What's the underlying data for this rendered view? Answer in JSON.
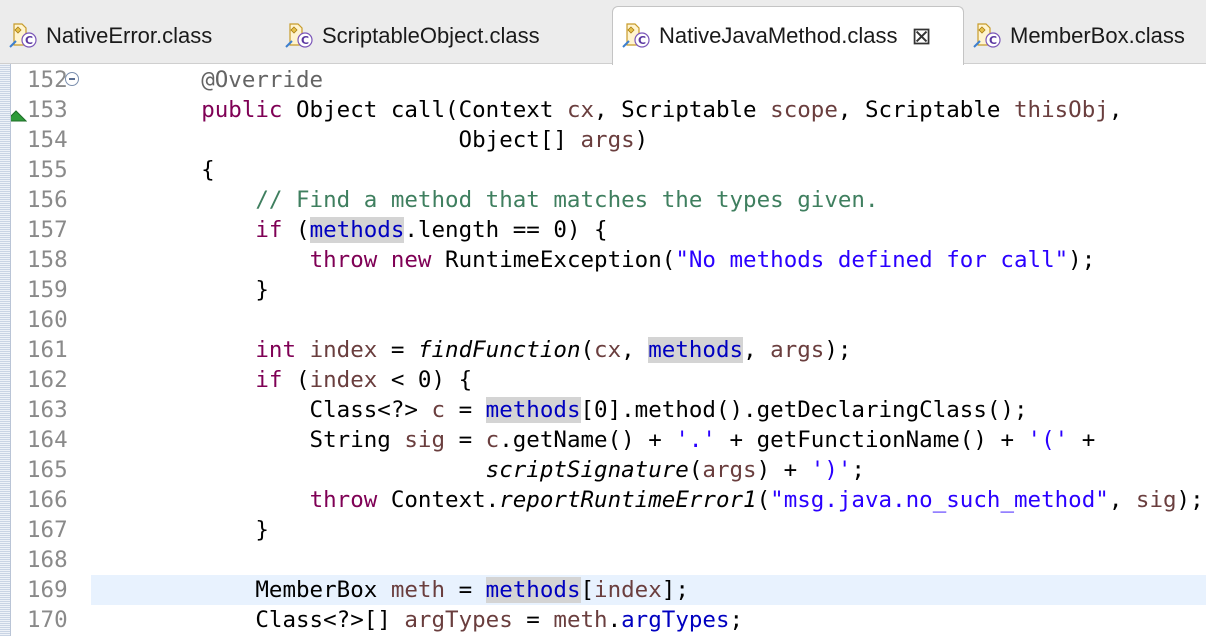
{
  "tabs": [
    {
      "label": "NativeError.class",
      "active": false,
      "icon": "class-file-icon"
    },
    {
      "label": "ScriptableObject.class",
      "active": false,
      "icon": "class-file-icon"
    },
    {
      "label": "NativeJavaMethod.class",
      "active": true,
      "icon": "class-file-icon",
      "close": "⊠"
    },
    {
      "label": "MemberBox.class",
      "active": false,
      "icon": "class-file-icon"
    }
  ],
  "colors": {
    "keyword": "#7f0055",
    "field": "#0000c0",
    "string": "#2a00ff",
    "comment": "#3f7f5f",
    "local_variable": "#6a3e3e",
    "annotation": "#646464",
    "current_line": "#e8f2fe",
    "occurrence_highlight": "#d4d4d4"
  },
  "editor": {
    "current_line": 169,
    "lines": [
      {
        "n": "152",
        "fold": "collapse",
        "tokens": [
          [
            "    ",
            ""
          ],
          [
            "@Override",
            "ann"
          ]
        ]
      },
      {
        "n": "153",
        "marker": "override-marker",
        "tokens": [
          [
            "    ",
            ""
          ],
          [
            "public",
            "kw"
          ],
          [
            " Object call(Context ",
            ""
          ],
          [
            "cx",
            "var"
          ],
          [
            ", Scriptable ",
            ""
          ],
          [
            "scope",
            "var"
          ],
          [
            ", Scriptable ",
            ""
          ],
          [
            "thisObj",
            "var"
          ],
          [
            ",",
            ""
          ]
        ]
      },
      {
        "n": "154",
        "tokens": [
          [
            "                       Object[] ",
            ""
          ],
          [
            "args",
            "var"
          ],
          [
            ")",
            ""
          ]
        ]
      },
      {
        "n": "155",
        "tokens": [
          [
            "    {",
            ""
          ]
        ]
      },
      {
        "n": "156",
        "tokens": [
          [
            "        ",
            ""
          ],
          [
            "// Find a method that matches the types given.",
            "cmt"
          ]
        ]
      },
      {
        "n": "157",
        "tokens": [
          [
            "        ",
            ""
          ],
          [
            "if",
            "kw"
          ],
          [
            " (",
            ""
          ],
          [
            "methods",
            "fld hl"
          ],
          [
            ".length == 0) {",
            ""
          ]
        ]
      },
      {
        "n": "158",
        "tokens": [
          [
            "            ",
            ""
          ],
          [
            "throw",
            "kw"
          ],
          [
            " ",
            ""
          ],
          [
            "new",
            "kw"
          ],
          [
            " RuntimeException(",
            ""
          ],
          [
            "\"No methods defined for call\"",
            "str"
          ],
          [
            ");",
            ""
          ]
        ]
      },
      {
        "n": "159",
        "tokens": [
          [
            "        }",
            ""
          ]
        ]
      },
      {
        "n": "160",
        "tokens": []
      },
      {
        "n": "161",
        "tokens": [
          [
            "        ",
            ""
          ],
          [
            "int",
            "kw"
          ],
          [
            " ",
            ""
          ],
          [
            "index",
            "var"
          ],
          [
            " = ",
            ""
          ],
          [
            "findFunction",
            "ital"
          ],
          [
            "(",
            ""
          ],
          [
            "cx",
            "var"
          ],
          [
            ", ",
            ""
          ],
          [
            "methods",
            "fld hl"
          ],
          [
            ", ",
            ""
          ],
          [
            "args",
            "var"
          ],
          [
            ");",
            ""
          ]
        ]
      },
      {
        "n": "162",
        "tokens": [
          [
            "        ",
            ""
          ],
          [
            "if",
            "kw"
          ],
          [
            " (",
            ""
          ],
          [
            "index",
            "var"
          ],
          [
            " < 0) {",
            ""
          ]
        ]
      },
      {
        "n": "163",
        "tokens": [
          [
            "            Class<?> ",
            ""
          ],
          [
            "c",
            "var"
          ],
          [
            " = ",
            ""
          ],
          [
            "methods",
            "fld hl"
          ],
          [
            "[0].method().getDeclaringClass();",
            ""
          ]
        ]
      },
      {
        "n": "164",
        "tokens": [
          [
            "            String ",
            ""
          ],
          [
            "sig",
            "var"
          ],
          [
            " = ",
            ""
          ],
          [
            "c",
            "var"
          ],
          [
            ".getName() + ",
            ""
          ],
          [
            "'.'",
            "str"
          ],
          [
            " + getFunctionName() + ",
            ""
          ],
          [
            "'('",
            "str"
          ],
          [
            " +",
            ""
          ]
        ]
      },
      {
        "n": "165",
        "tokens": [
          [
            "                         ",
            ""
          ],
          [
            "scriptSignature",
            "ital"
          ],
          [
            "(",
            ""
          ],
          [
            "args",
            "var"
          ],
          [
            ") + ",
            ""
          ],
          [
            "')'",
            "str"
          ],
          [
            ";",
            ""
          ]
        ]
      },
      {
        "n": "166",
        "tokens": [
          [
            "            ",
            ""
          ],
          [
            "throw",
            "kw"
          ],
          [
            " Context.",
            ""
          ],
          [
            "reportRuntimeError1",
            "ital"
          ],
          [
            "(",
            ""
          ],
          [
            "\"msg.java.no_such_method\"",
            "str"
          ],
          [
            ", ",
            ""
          ],
          [
            "sig",
            "var"
          ],
          [
            ");",
            ""
          ]
        ]
      },
      {
        "n": "167",
        "tokens": [
          [
            "        }",
            ""
          ]
        ]
      },
      {
        "n": "168",
        "tokens": []
      },
      {
        "n": "169",
        "tokens": [
          [
            "        MemberBox ",
            ""
          ],
          [
            "meth",
            "var"
          ],
          [
            " = ",
            ""
          ],
          [
            "methods",
            "fld hl"
          ],
          [
            "[",
            ""
          ],
          [
            "index",
            "var"
          ],
          [
            "];",
            ""
          ]
        ]
      },
      {
        "n": "170",
        "tokens": [
          [
            "        Class<?>[] ",
            ""
          ],
          [
            "argTypes",
            "var"
          ],
          [
            " = ",
            ""
          ],
          [
            "meth",
            "var"
          ],
          [
            ".",
            ""
          ],
          [
            "argTypes",
            "fld"
          ],
          [
            ";",
            ""
          ]
        ]
      }
    ]
  }
}
